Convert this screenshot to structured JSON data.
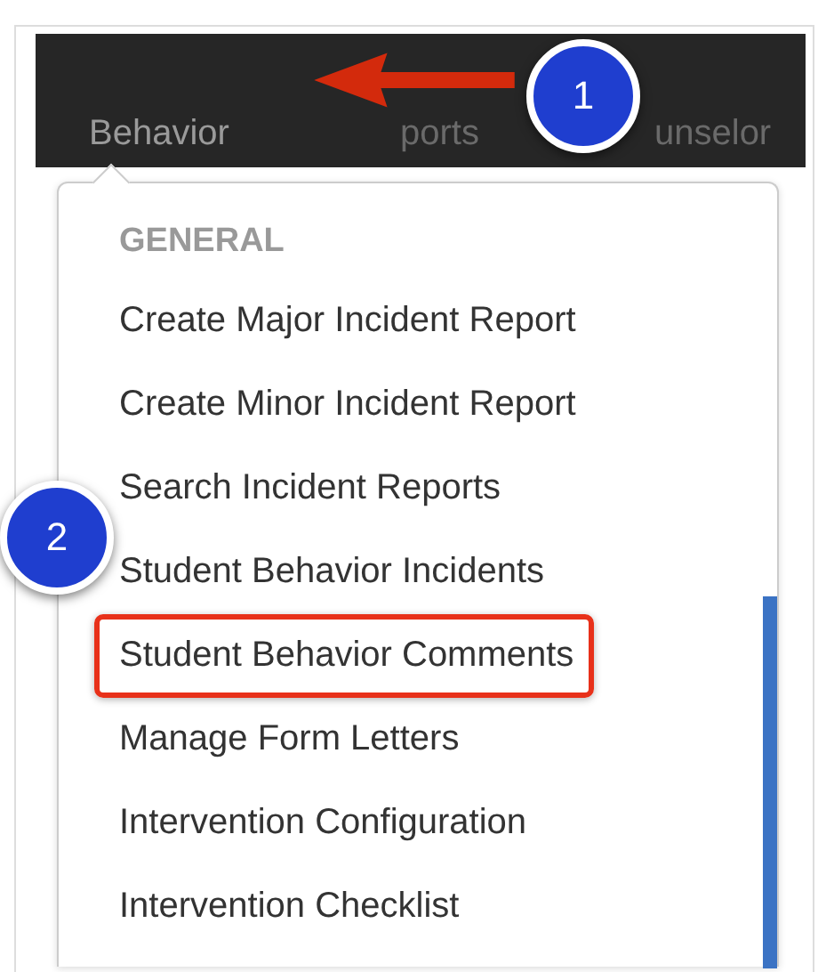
{
  "nav_tabs": [
    {
      "label": "Behavior",
      "selected": true
    },
    {
      "label": "ports",
      "selected": false
    },
    {
      "label": "unselor",
      "selected": false
    }
  ],
  "menu": {
    "section": "GENERAL",
    "items": [
      {
        "label": "Create Major Incident Report",
        "highlighted": false
      },
      {
        "label": "Create Minor Incident Report",
        "highlighted": false
      },
      {
        "label": "Search Incident Reports",
        "highlighted": false
      },
      {
        "label": "Student Behavior Incidents",
        "highlighted": false
      },
      {
        "label": "Student Behavior Comments",
        "highlighted": true
      },
      {
        "label": "Manage Form Letters",
        "highlighted": false
      },
      {
        "label": "Intervention Configuration",
        "highlighted": false
      },
      {
        "label": "Intervention Checklist",
        "highlighted": false
      }
    ]
  },
  "callouts": [
    "1",
    "2"
  ]
}
